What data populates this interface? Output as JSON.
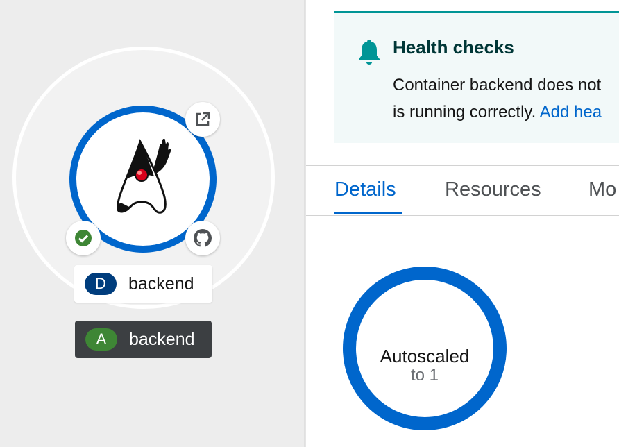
{
  "topology": {
    "deployment_label": {
      "badge": "D",
      "name": "backend"
    },
    "application_label": {
      "badge": "A",
      "name": "backend"
    },
    "pod_status": "running",
    "decorators": [
      "open-url-icon",
      "status-check-icon",
      "github-icon"
    ],
    "runtime_icon": "java-duke-icon"
  },
  "alert": {
    "title": "Health checks",
    "line1": "Container backend does not",
    "line2_prefix": "is running correctly. ",
    "line2_link": "Add hea"
  },
  "tabs": [
    {
      "label": "Details",
      "active": true
    },
    {
      "label": "Resources",
      "active": false
    },
    {
      "label": "Mo",
      "active": false
    }
  ],
  "donut": {
    "title": "Autoscaled",
    "subtitle": "to 1"
  },
  "colors": {
    "accent": "#0066cc",
    "success": "#3e8635",
    "alert_border": "#009596"
  }
}
